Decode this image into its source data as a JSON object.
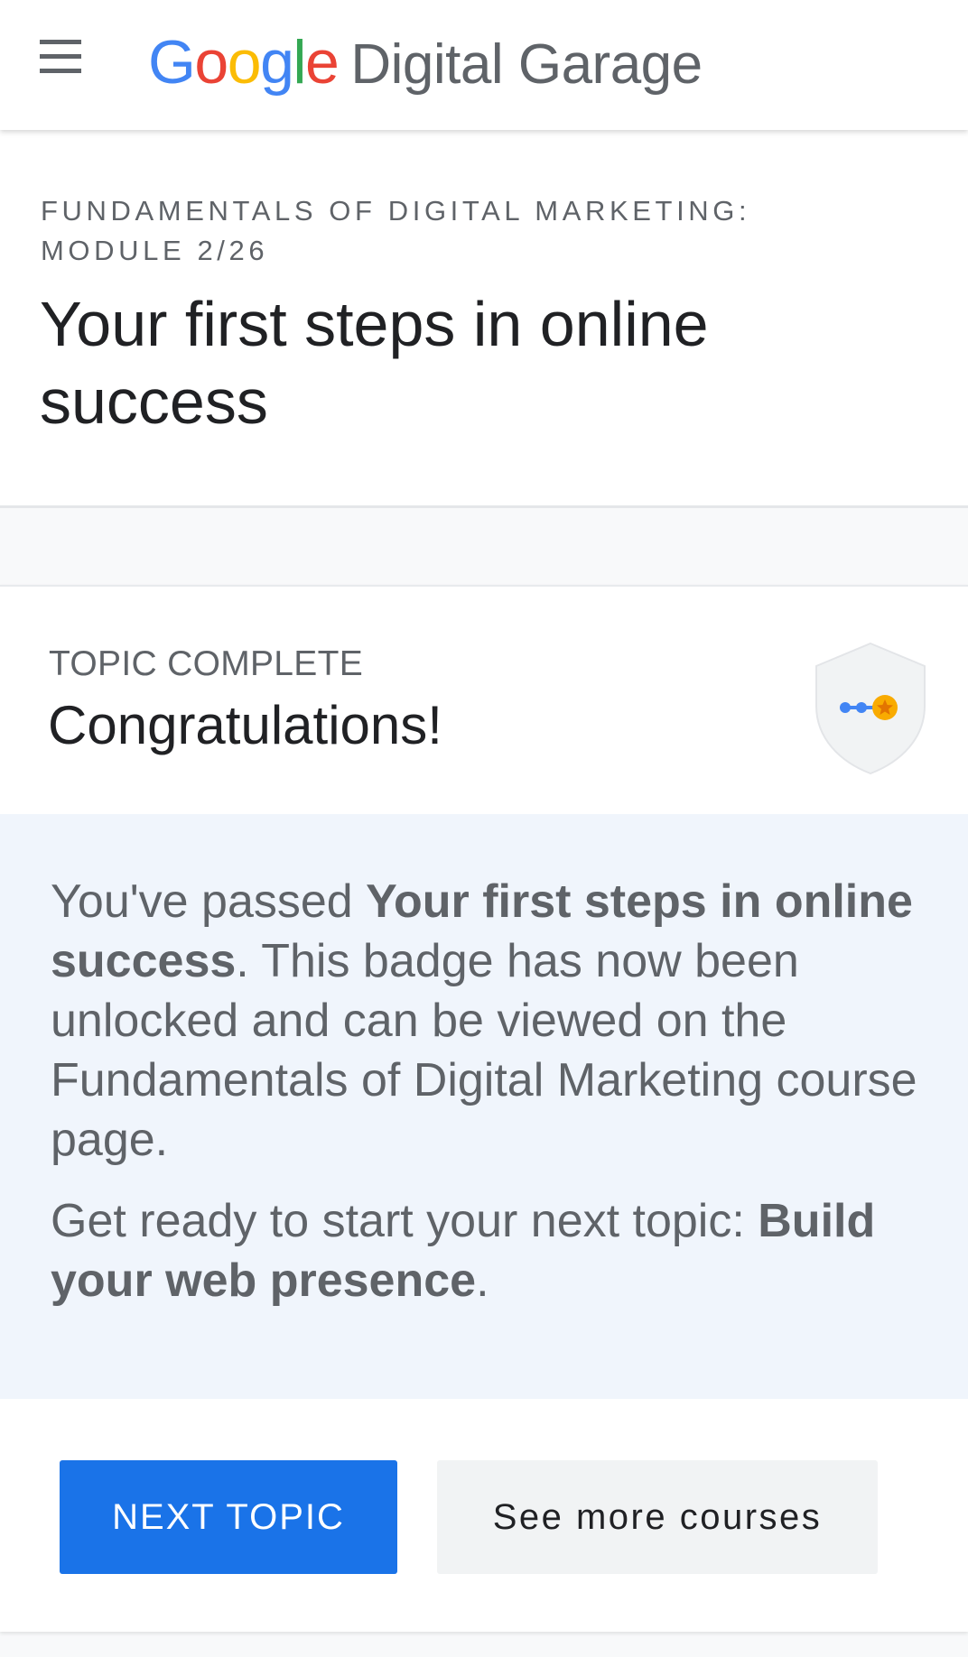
{
  "appbar": {
    "menu_icon": "hamburger-menu-icon",
    "logo": {
      "google_letters": [
        {
          "char": "G",
          "color": "#4285f4"
        },
        {
          "char": "o",
          "color": "#ea4335"
        },
        {
          "char": "o",
          "color": "#fbbc05"
        },
        {
          "char": "g",
          "color": "#4285f4"
        },
        {
          "char": "l",
          "color": "#34a853"
        },
        {
          "char": "e",
          "color": "#ea4335"
        }
      ],
      "product": "Digital Garage"
    }
  },
  "module": {
    "eyebrow": "FUNDAMENTALS OF DIGITAL MARKETING: MODULE 2/26",
    "title": "Your first steps in online success"
  },
  "card": {
    "eyebrow": "TOPIC COMPLETE",
    "title": "Congratulations!",
    "badge_icon": "shield-badge-icon",
    "message": {
      "p1_pre": "You've passed ",
      "p1_bold": "Your first steps in online success",
      "p1_post": ". This badge has now been unlocked and can be viewed on the Fundamentals of Digital Marketing course page.",
      "p2_pre": "Get ready to start your next topic: ",
      "p2_bold": "Build your web presence",
      "p2_post": "."
    },
    "buttons": {
      "next": "NEXT TOPIC",
      "more": "See more courses"
    }
  },
  "colors": {
    "primary": "#1a73e8",
    "message_bg": "#f0f5fc",
    "secondary_bg": "#f1f3f4",
    "badge_star": "#f9ab00",
    "badge_dots": "#4285f4"
  }
}
